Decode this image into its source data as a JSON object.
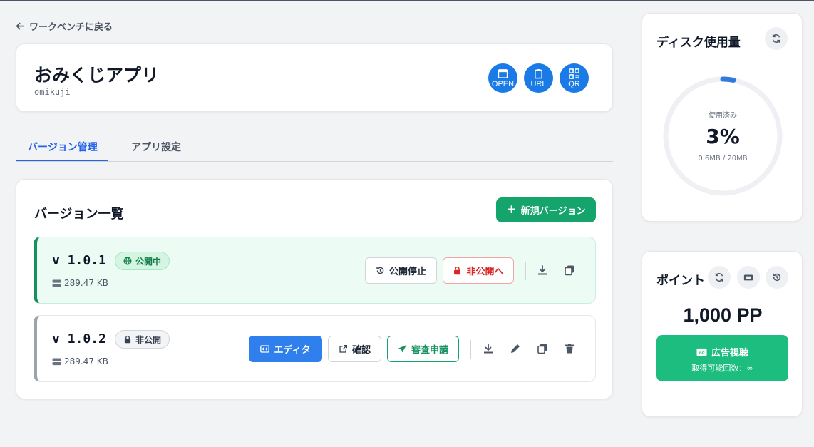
{
  "nav": {
    "back_label": "ワークベンチに戻る"
  },
  "app": {
    "title": "おみくじアプリ",
    "slug": "omikuji",
    "actions": {
      "open": "OPEN",
      "url": "URL",
      "qr": "QR"
    },
    "accent_color": "#1a7ae6"
  },
  "tabs": [
    {
      "label": "バージョン管理",
      "active": true
    },
    {
      "label": "アプリ設定",
      "active": false
    }
  ],
  "versions": {
    "title": "バージョン一覧",
    "new_button": "新規バージョン",
    "items": [
      {
        "version": "v 1.0.1",
        "status": "公開中",
        "size": "289.47 KB",
        "buttons": {
          "stop": "公開停止",
          "unpublish": "非公開へ"
        },
        "icons": [
          "download-icon",
          "copy-icon"
        ]
      },
      {
        "version": "v 1.0.2",
        "status": "非公開",
        "size": "289.47 KB",
        "buttons": {
          "editor": "エディタ",
          "confirm": "確認",
          "review": "審査申請"
        },
        "icons": [
          "download-icon",
          "pencil-icon",
          "copy-icon",
          "trash-icon"
        ]
      }
    ]
  },
  "disk": {
    "title": "ディスク使用量",
    "used_label": "使用済み",
    "percent": "3%",
    "percent_value": 3,
    "usage": "0.6MB / 20MB"
  },
  "points": {
    "title": "ポイント",
    "value": "1,000 PP",
    "ad_button": "広告視聴",
    "ad_sub": "取得可能回数：∞"
  },
  "colors": {
    "primary_green": "#14a46c",
    "blue": "#2f80ed",
    "danger": "#dc2626"
  }
}
